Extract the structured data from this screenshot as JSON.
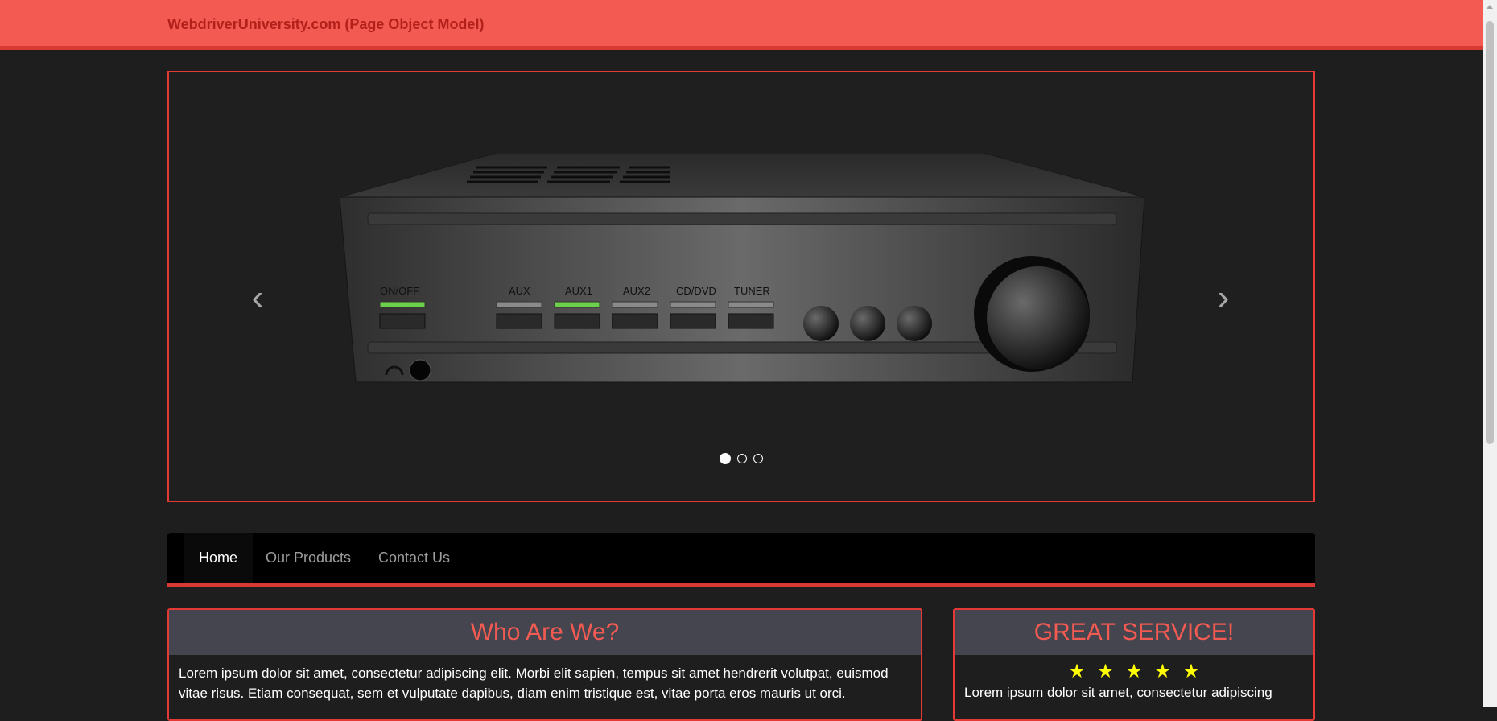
{
  "header": {
    "brand": "WebdriverUniversity.com (Page Object Model)"
  },
  "carousel": {
    "prev_symbol": "‹",
    "next_symbol": "›",
    "slide_count": 3,
    "active_slide": 1,
    "amplifier_labels": [
      "ON/OFF",
      "AUX",
      "AUX1",
      "AUX2",
      "CD/DVD",
      "TUNER"
    ]
  },
  "nav": {
    "items": [
      {
        "label": "Home"
      },
      {
        "label": "Our Products"
      },
      {
        "label": "Contact Us"
      }
    ]
  },
  "panels": {
    "who": {
      "title": "Who Are We?",
      "text": "Lorem ipsum dolor sit amet, consectetur adipiscing elit. Morbi elit sapien, tempus sit amet hendrerit volutpat, euismod vitae risus. Etiam consequat, sem et vulputate dapibus, diam enim tristique est, vitae porta eros mauris ut orci."
    },
    "service": {
      "title": "GREAT SERVICE!",
      "stars": "★★★★★",
      "rating": 5,
      "text": "Lorem ipsum dolor sit amet, consectetur adipiscing"
    }
  },
  "colors": {
    "accent": "#e53935",
    "header_bg": "#f25a52",
    "star": "#ffff00"
  }
}
